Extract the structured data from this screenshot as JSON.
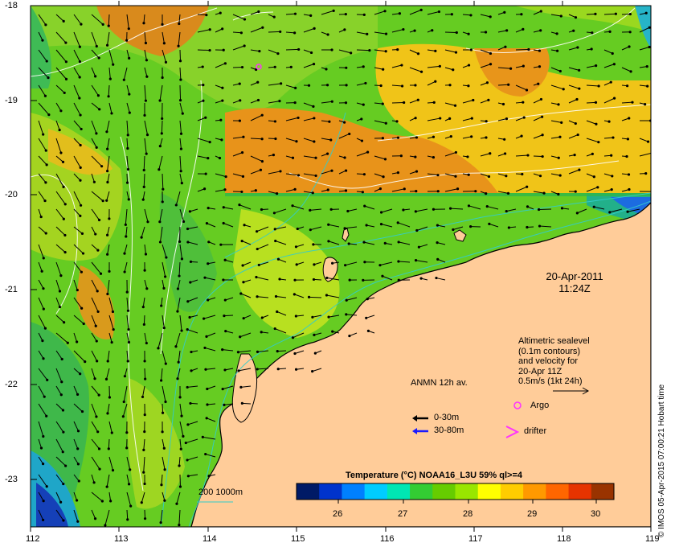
{
  "map": {
    "lon_ticks": [
      "112",
      "113",
      "114",
      "115",
      "116",
      "117",
      "118",
      "119"
    ],
    "lat_ticks": [
      "-18",
      "-19",
      "-20",
      "-21",
      "-22",
      "-23"
    ],
    "timestamp": {
      "date": "20-Apr-2011",
      "time": "11:24Z"
    },
    "credit": "© IMOS 05-Apr-2015 07:00:21 Hobart time",
    "altimetry_note": [
      "Altimetric sealevel",
      "(0.1m contours)",
      "and velocity for",
      "20-Apr 11Z",
      "0.5m/s (1kt 24h)"
    ],
    "anmn": {
      "title": "ANMN 12h av.",
      "items": [
        {
          "label": "0-30m",
          "color": "#000000"
        },
        {
          "label": "30-80m",
          "color": "#1a1aff"
        }
      ]
    },
    "markers": [
      {
        "label": "Argo",
        "color": "#ff33ff",
        "icon": "argo-circle-icon"
      },
      {
        "label": "drifter",
        "color": "#ff33ff",
        "icon": "drifter-chevron-icon"
      }
    ],
    "contour_legend": "200  1000m",
    "colorbar": {
      "title": "Temperature (°C) NOAA16_L3U 59% ql>=4",
      "ticks": [
        "26",
        "27",
        "28",
        "29",
        "30"
      ],
      "colors": [
        "#001a66",
        "#0033cc",
        "#0080ff",
        "#00ccff",
        "#00e6b3",
        "#33cc33",
        "#66cc00",
        "#99e600",
        "#ffff00",
        "#ffcc00",
        "#ff9900",
        "#ff6600",
        "#e63300",
        "#993300"
      ]
    },
    "colors": {
      "land": "#ffcc99",
      "sea_base": "#66cc33",
      "coast": "#000000"
    }
  }
}
